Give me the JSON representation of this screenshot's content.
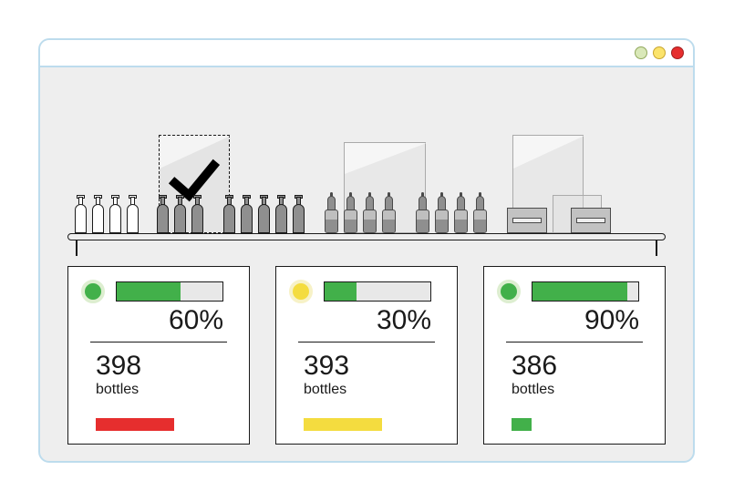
{
  "cards": [
    {
      "status": "green",
      "progress_pct": 60,
      "pct_label": "60%",
      "count": "398",
      "unit": "bottles",
      "swatch": "red"
    },
    {
      "status": "yellow",
      "progress_pct": 30,
      "pct_label": "30%",
      "count": "393",
      "unit": "bottles",
      "swatch": "yellow"
    },
    {
      "status": "green",
      "progress_pct": 90,
      "pct_label": "90%",
      "count": "386",
      "unit": "bottles",
      "swatch": "green"
    }
  ],
  "colors": {
    "green": "#42B04A",
    "yellow": "#F4DC3F",
    "red": "#E62E2E"
  },
  "chart_data": [
    {
      "type": "bar",
      "title": "",
      "categories": [
        "progress"
      ],
      "values": [
        60
      ],
      "ylim": [
        0,
        100
      ],
      "series_color": "#42B04A"
    },
    {
      "type": "bar",
      "title": "",
      "categories": [
        "progress"
      ],
      "values": [
        30
      ],
      "ylim": [
        0,
        100
      ],
      "series_color": "#42B04A"
    },
    {
      "type": "bar",
      "title": "",
      "categories": [
        "progress"
      ],
      "values": [
        90
      ],
      "ylim": [
        0,
        100
      ],
      "series_color": "#42B04A"
    }
  ]
}
